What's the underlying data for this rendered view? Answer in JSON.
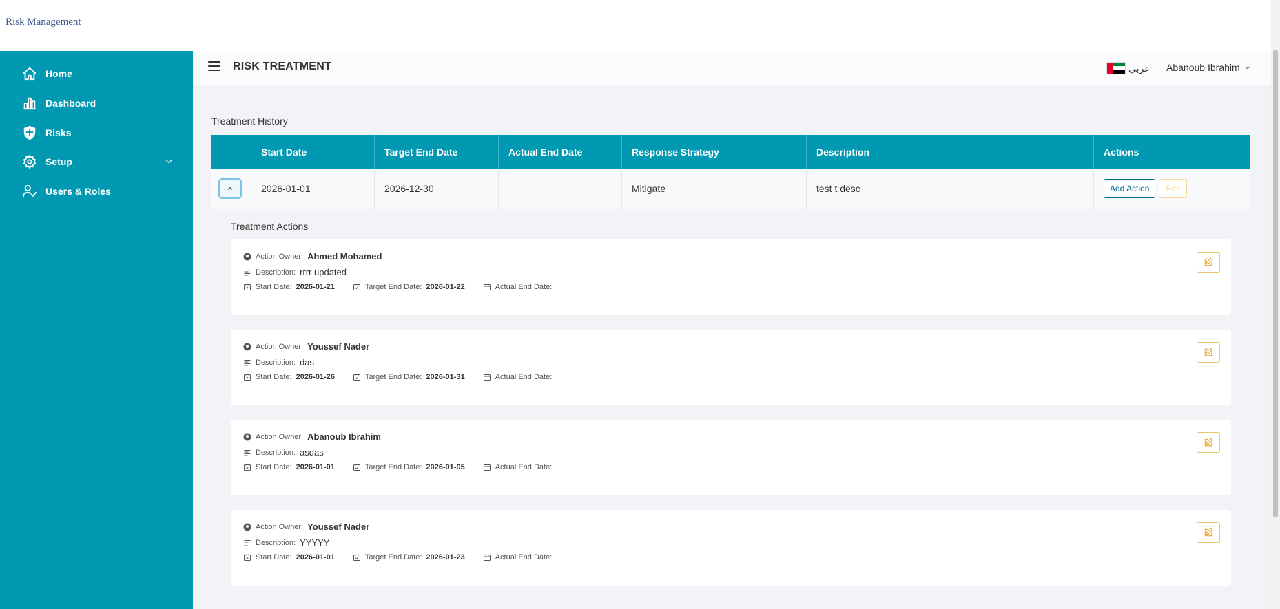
{
  "app": {
    "brand": "Risk Management"
  },
  "sidebar": {
    "items": [
      {
        "label": "Home",
        "icon": "home-icon"
      },
      {
        "label": "Dashboard",
        "icon": "bar-chart-icon"
      },
      {
        "label": "Risks",
        "icon": "shield-icon"
      },
      {
        "label": "Setup",
        "icon": "gear-icon"
      },
      {
        "label": "Users & Roles",
        "icon": "user-check-icon"
      }
    ]
  },
  "header": {
    "title": "RISK TREATMENT",
    "language_label": "عربي",
    "user_name": "Abanoub Ibrahim"
  },
  "history": {
    "title": "Treatment History",
    "columns": [
      "Start Date",
      "Target End Date",
      "Actual End Date",
      "Response Strategy",
      "Description",
      "Actions"
    ],
    "rows": [
      {
        "start_date": "2026-01-01",
        "target_end_date": "2026-12-30",
        "actual_end_date": "",
        "strategy": "Mitigate",
        "description": "test t desc"
      }
    ],
    "add_action_label": "Add Action",
    "edit_label": "Edit"
  },
  "actions": {
    "title": "Treatment Actions",
    "labels": {
      "owner": "Action Owner:",
      "description": "Description:",
      "start": "Start Date:",
      "target": "Target End Date:",
      "actual": "Actual End Date:"
    },
    "items": [
      {
        "owner": "Ahmed Mohamed",
        "description": "rrrr updated",
        "start": "2026-01-21",
        "target": "2026-01-22",
        "actual": ""
      },
      {
        "owner": "Youssef Nader",
        "description": "das",
        "start": "2026-01-26",
        "target": "2026-01-31",
        "actual": ""
      },
      {
        "owner": "Abanoub Ibrahim",
        "description": "asdas",
        "start": "2026-01-01",
        "target": "2026-01-05",
        "actual": ""
      },
      {
        "owner": "Youssef Nader",
        "description": "YYYYY",
        "start": "2026-01-01",
        "target": "2026-01-23",
        "actual": ""
      }
    ]
  },
  "colors": {
    "primary": "#0099b1",
    "accent_edit": "#f0c36d",
    "background": "#f1f3f6"
  }
}
